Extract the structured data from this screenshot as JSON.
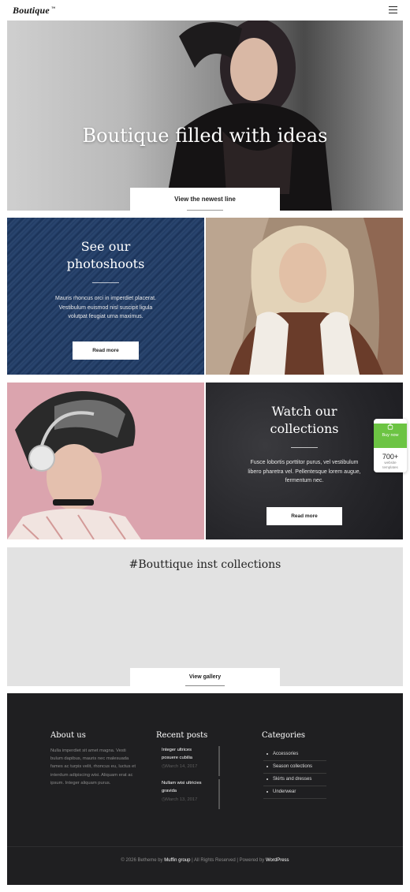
{
  "header": {
    "logo": "Boutique",
    "logo_mark": "™",
    "menu_icon": "hamburger-menu-icon"
  },
  "hero": {
    "title": "Boutique filled with ideas",
    "button": "View the newest line"
  },
  "photoshoots": {
    "title_line1": "See our",
    "title_line2": "photoshoots",
    "text_line1": "Mauris rhoncus orci in imperdiet placerat.",
    "text_line2": "Vestibulum euismod nisl suscipit ligula",
    "text_line3": "volutpat feugiat urna maximus.",
    "button": "Read more"
  },
  "collections": {
    "title_line1": "Watch our",
    "title_line2": "collections",
    "text_line1": "Fusce lobortis porttitor purus, vel vestibulum",
    "text_line2": "libero pharetra vel. Pellentesque lorem augue,",
    "text_line3": "fermentum nec.",
    "button": "Read more"
  },
  "buy_widget": {
    "label": "Buy now",
    "count": "700+",
    "sub_line1": "website",
    "sub_line2": "templates",
    "accent": "#6cc443",
    "icon": "cart-icon"
  },
  "insta": {
    "title": "#Bouttique inst collections",
    "button": "View gallery"
  },
  "footer": {
    "about_title": "About us",
    "about_text": "Nulla imperdiet sit amet magna. Vesti bulum dapibus, mauris nec malesuada fames ac turpis velit, rhoncus eu, luctus et interdum adipiscing wisi. Aliquam erat ac ipsum. Integer aliquam purus.",
    "recent_title": "Recent posts",
    "posts": [
      {
        "title_line1": "Integer ultrices",
        "title_line2": "posuere cubilia",
        "date": "March 14, 2017"
      },
      {
        "title_line1": "Nullam wisi ultricies",
        "title_line2": "gravida",
        "date": "March 13, 2017"
      }
    ],
    "categories_title": "Categories",
    "categories": [
      "Accessories",
      "Season collections",
      "Skirts and dresses",
      "Underwear"
    ],
    "copyright_prefix": "© 2026 Betheme by",
    "copyright_brand": "Muffin group",
    "copyright_middle": "| All Rights Reserved | Powered by",
    "copyright_platform": "WordPress"
  }
}
